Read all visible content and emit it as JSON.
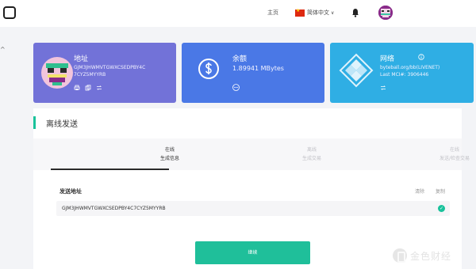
{
  "header": {
    "home_label": "主页",
    "language_label": "简体中文",
    "language_chevron": "∨"
  },
  "sidebar": {
    "caret": "^"
  },
  "cards": {
    "address": {
      "title": "地址",
      "line1": "GJM3JHWMVTGWXCSEDPBY4C",
      "line2": "7CYZ5MYYRB"
    },
    "balance": {
      "title": "余额",
      "amount": "1.89941 MBytes"
    },
    "network": {
      "title": "网络",
      "line1": "byteball.org/bb(LIVENET)",
      "line2": "Last MCI#: 3906446"
    }
  },
  "offline": {
    "title": "离线发送",
    "steps": [
      {
        "line1": "在线",
        "line2": "生成信息",
        "active": true
      },
      {
        "line1": "离线",
        "line2": "生成交易",
        "active": false
      },
      {
        "line1": "在线",
        "line2": "发送/检查交易",
        "active": false
      }
    ],
    "field_label": "发送地址",
    "clear_label": "清除",
    "copy_label": "复制",
    "address_value": "GJM3JHWMVTGWXCSEDPBY4C7CYZ5MYYRB",
    "continue_label": "继续"
  },
  "watermark": {
    "text": "金色财经"
  },
  "colors": {
    "address_card": "#7272d8",
    "balance_card": "#4a78e6",
    "network_card": "#2faee4",
    "accent": "#19c29b",
    "button": "#1fbf9a"
  }
}
